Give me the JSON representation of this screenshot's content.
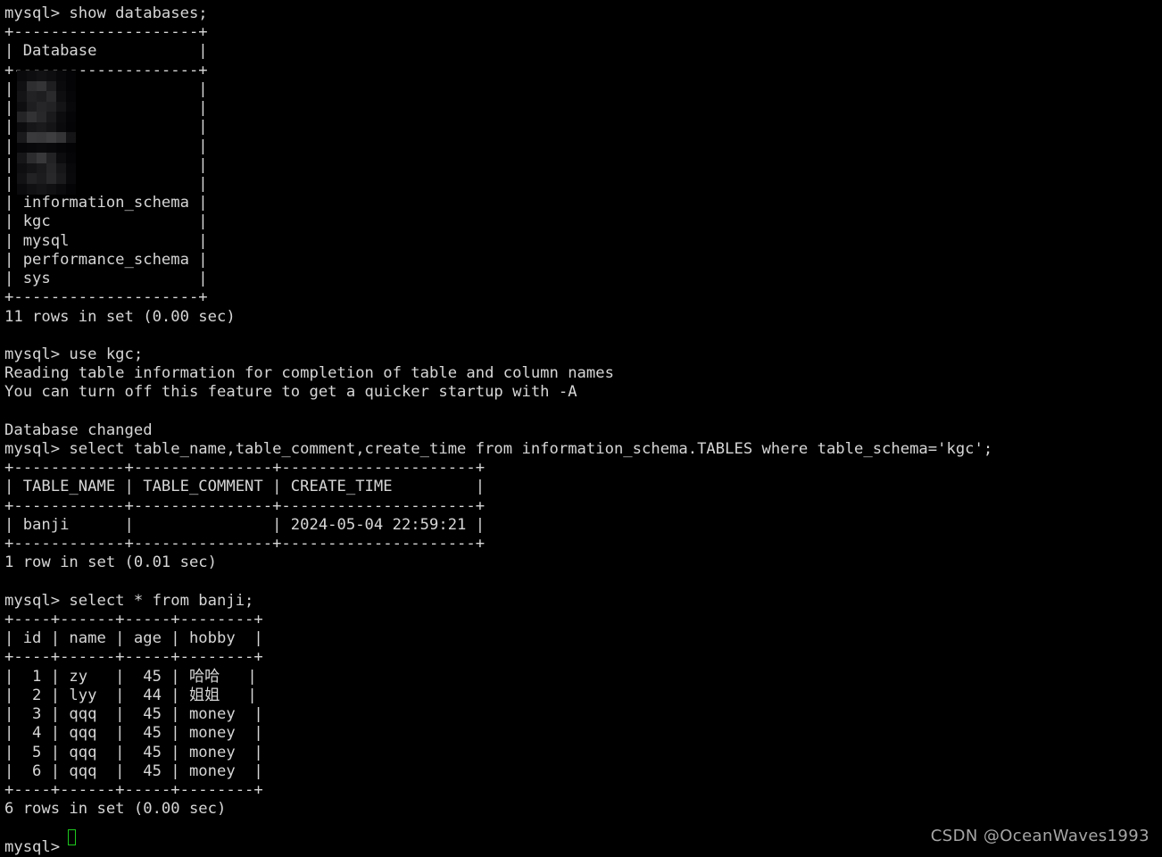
{
  "terminal": {
    "background_color": "#000000",
    "foreground_color": "#d6d6d6",
    "cursor_color": "#1ec81e",
    "prompt": "mysql> "
  },
  "session": {
    "lines": [
      {
        "id": "cmd-show-databases",
        "kind": "command",
        "text": "mysql> show databases;"
      },
      {
        "id": "db-sep-top",
        "kind": "rule",
        "text": "+--------------------+"
      },
      {
        "id": "db-header",
        "kind": "header",
        "text": "| Database           |"
      },
      {
        "id": "db-sep-mid",
        "kind": "rule",
        "text": "+--------------------+"
      },
      {
        "id": "db-row-1",
        "kind": "row",
        "text": "|                    |"
      },
      {
        "id": "db-row-2",
        "kind": "row",
        "text": "|                    |"
      },
      {
        "id": "db-row-3",
        "kind": "row",
        "text": "|                    |"
      },
      {
        "id": "db-row-4",
        "kind": "row",
        "text": "|                    |"
      },
      {
        "id": "db-row-5",
        "kind": "row",
        "text": "|                    |"
      },
      {
        "id": "db-row-6",
        "kind": "row",
        "text": "|                    |"
      },
      {
        "id": "db-row-7",
        "kind": "row",
        "text": "| information_schema |"
      },
      {
        "id": "db-row-8",
        "kind": "row",
        "text": "| kgc                |"
      },
      {
        "id": "db-row-9",
        "kind": "row",
        "text": "| mysql              |"
      },
      {
        "id": "db-row-10",
        "kind": "row",
        "text": "| performance_schema |"
      },
      {
        "id": "db-row-11",
        "kind": "row",
        "text": "| sys                |"
      },
      {
        "id": "db-sep-bottom",
        "kind": "rule",
        "text": "+--------------------+"
      },
      {
        "id": "db-rowcount",
        "kind": "status",
        "text": "11 rows in set (0.00 sec)"
      },
      {
        "id": "blank-1",
        "kind": "blank",
        "text": " "
      },
      {
        "id": "cmd-use-kgc",
        "kind": "command",
        "text": "mysql> use kgc;"
      },
      {
        "id": "msg-reading",
        "kind": "output",
        "text": "Reading table information for completion of table and column names"
      },
      {
        "id": "msg-turnoff",
        "kind": "output",
        "text": "You can turn off this feature to get a quicker startup with -A"
      },
      {
        "id": "blank-2",
        "kind": "blank",
        "text": " "
      },
      {
        "id": "msg-dbchanged",
        "kind": "output",
        "text": "Database changed"
      },
      {
        "id": "cmd-select-tables",
        "kind": "command",
        "text": "mysql> select table_name,table_comment,create_time from information_schema.TABLES where table_schema='kgc';"
      },
      {
        "id": "tbl-sep-top",
        "kind": "rule",
        "text": "+------------+---------------+---------------------+"
      },
      {
        "id": "tbl-header",
        "kind": "header",
        "text": "| TABLE_NAME | TABLE_COMMENT | CREATE_TIME         |"
      },
      {
        "id": "tbl-sep-mid",
        "kind": "rule",
        "text": "+------------+---------------+---------------------+"
      },
      {
        "id": "tbl-row-1",
        "kind": "row",
        "text": "| banji      |               | 2024-05-04 22:59:21 |"
      },
      {
        "id": "tbl-sep-bottom",
        "kind": "rule",
        "text": "+------------+---------------+---------------------+"
      },
      {
        "id": "tbl-rowcount",
        "kind": "status",
        "text": "1 row in set (0.01 sec)"
      },
      {
        "id": "blank-3",
        "kind": "blank",
        "text": " "
      },
      {
        "id": "cmd-select-banji",
        "kind": "command",
        "text": "mysql> select * from banji;"
      },
      {
        "id": "banji-sep-top",
        "kind": "rule",
        "text": "+----+------+-----+--------+"
      },
      {
        "id": "banji-header",
        "kind": "header",
        "text": "| id | name | age | hobby  |"
      },
      {
        "id": "banji-sep-mid",
        "kind": "rule",
        "text": "+----+------+-----+--------+"
      },
      {
        "id": "banji-row-1",
        "kind": "row",
        "text": "|  1 | zy   |  45 | 哈哈   |"
      },
      {
        "id": "banji-row-2",
        "kind": "row",
        "text": "|  2 | lyy  |  44 | 姐姐   |"
      },
      {
        "id": "banji-row-3",
        "kind": "row",
        "text": "|  3 | qqq  |  45 | money  |"
      },
      {
        "id": "banji-row-4",
        "kind": "row",
        "text": "|  4 | qqq  |  45 | money  |"
      },
      {
        "id": "banji-row-5",
        "kind": "row",
        "text": "|  5 | qqq  |  45 | money  |"
      },
      {
        "id": "banji-row-6",
        "kind": "row",
        "text": "|  6 | qqq  |  45 | money  |"
      },
      {
        "id": "banji-sep-bottom",
        "kind": "rule",
        "text": "+----+------+-----+--------+"
      },
      {
        "id": "banji-rowcount",
        "kind": "status",
        "text": "6 rows in set (0.00 sec)"
      },
      {
        "id": "blank-4",
        "kind": "blank",
        "text": " "
      },
      {
        "id": "prompt-final",
        "kind": "prompt",
        "text": "mysql> "
      }
    ]
  },
  "results": {
    "databases": {
      "column_header": "Database",
      "values": [
        "",
        "",
        "",
        "",
        "",
        "",
        "information_schema",
        "kgc",
        "mysql",
        "performance_schema",
        "sys"
      ],
      "redacted_count": 6,
      "row_count_text": "11 rows in set (0.00 sec)"
    },
    "tables_query": {
      "columns": [
        "TABLE_NAME",
        "TABLE_COMMENT",
        "CREATE_TIME"
      ],
      "rows": [
        [
          "banji",
          "",
          "2024-05-04 22:59:21"
        ]
      ],
      "row_count_text": "1 row in set (0.01 sec)"
    },
    "banji_table": {
      "columns": [
        "id",
        "name",
        "age",
        "hobby"
      ],
      "rows": [
        [
          "1",
          "zy",
          "45",
          "哈哈"
        ],
        [
          "2",
          "lyy",
          "44",
          "姐姐"
        ],
        [
          "3",
          "qqq",
          "45",
          "money"
        ],
        [
          "4",
          "qqq",
          "45",
          "money"
        ],
        [
          "5",
          "qqq",
          "45",
          "money"
        ],
        [
          "6",
          "qqq",
          "45",
          "money"
        ]
      ],
      "row_count_text": "6 rows in set (0.00 sec)"
    }
  },
  "watermark": {
    "text": "CSDN @OceanWaves1993",
    "color": "#a6a6a6"
  }
}
